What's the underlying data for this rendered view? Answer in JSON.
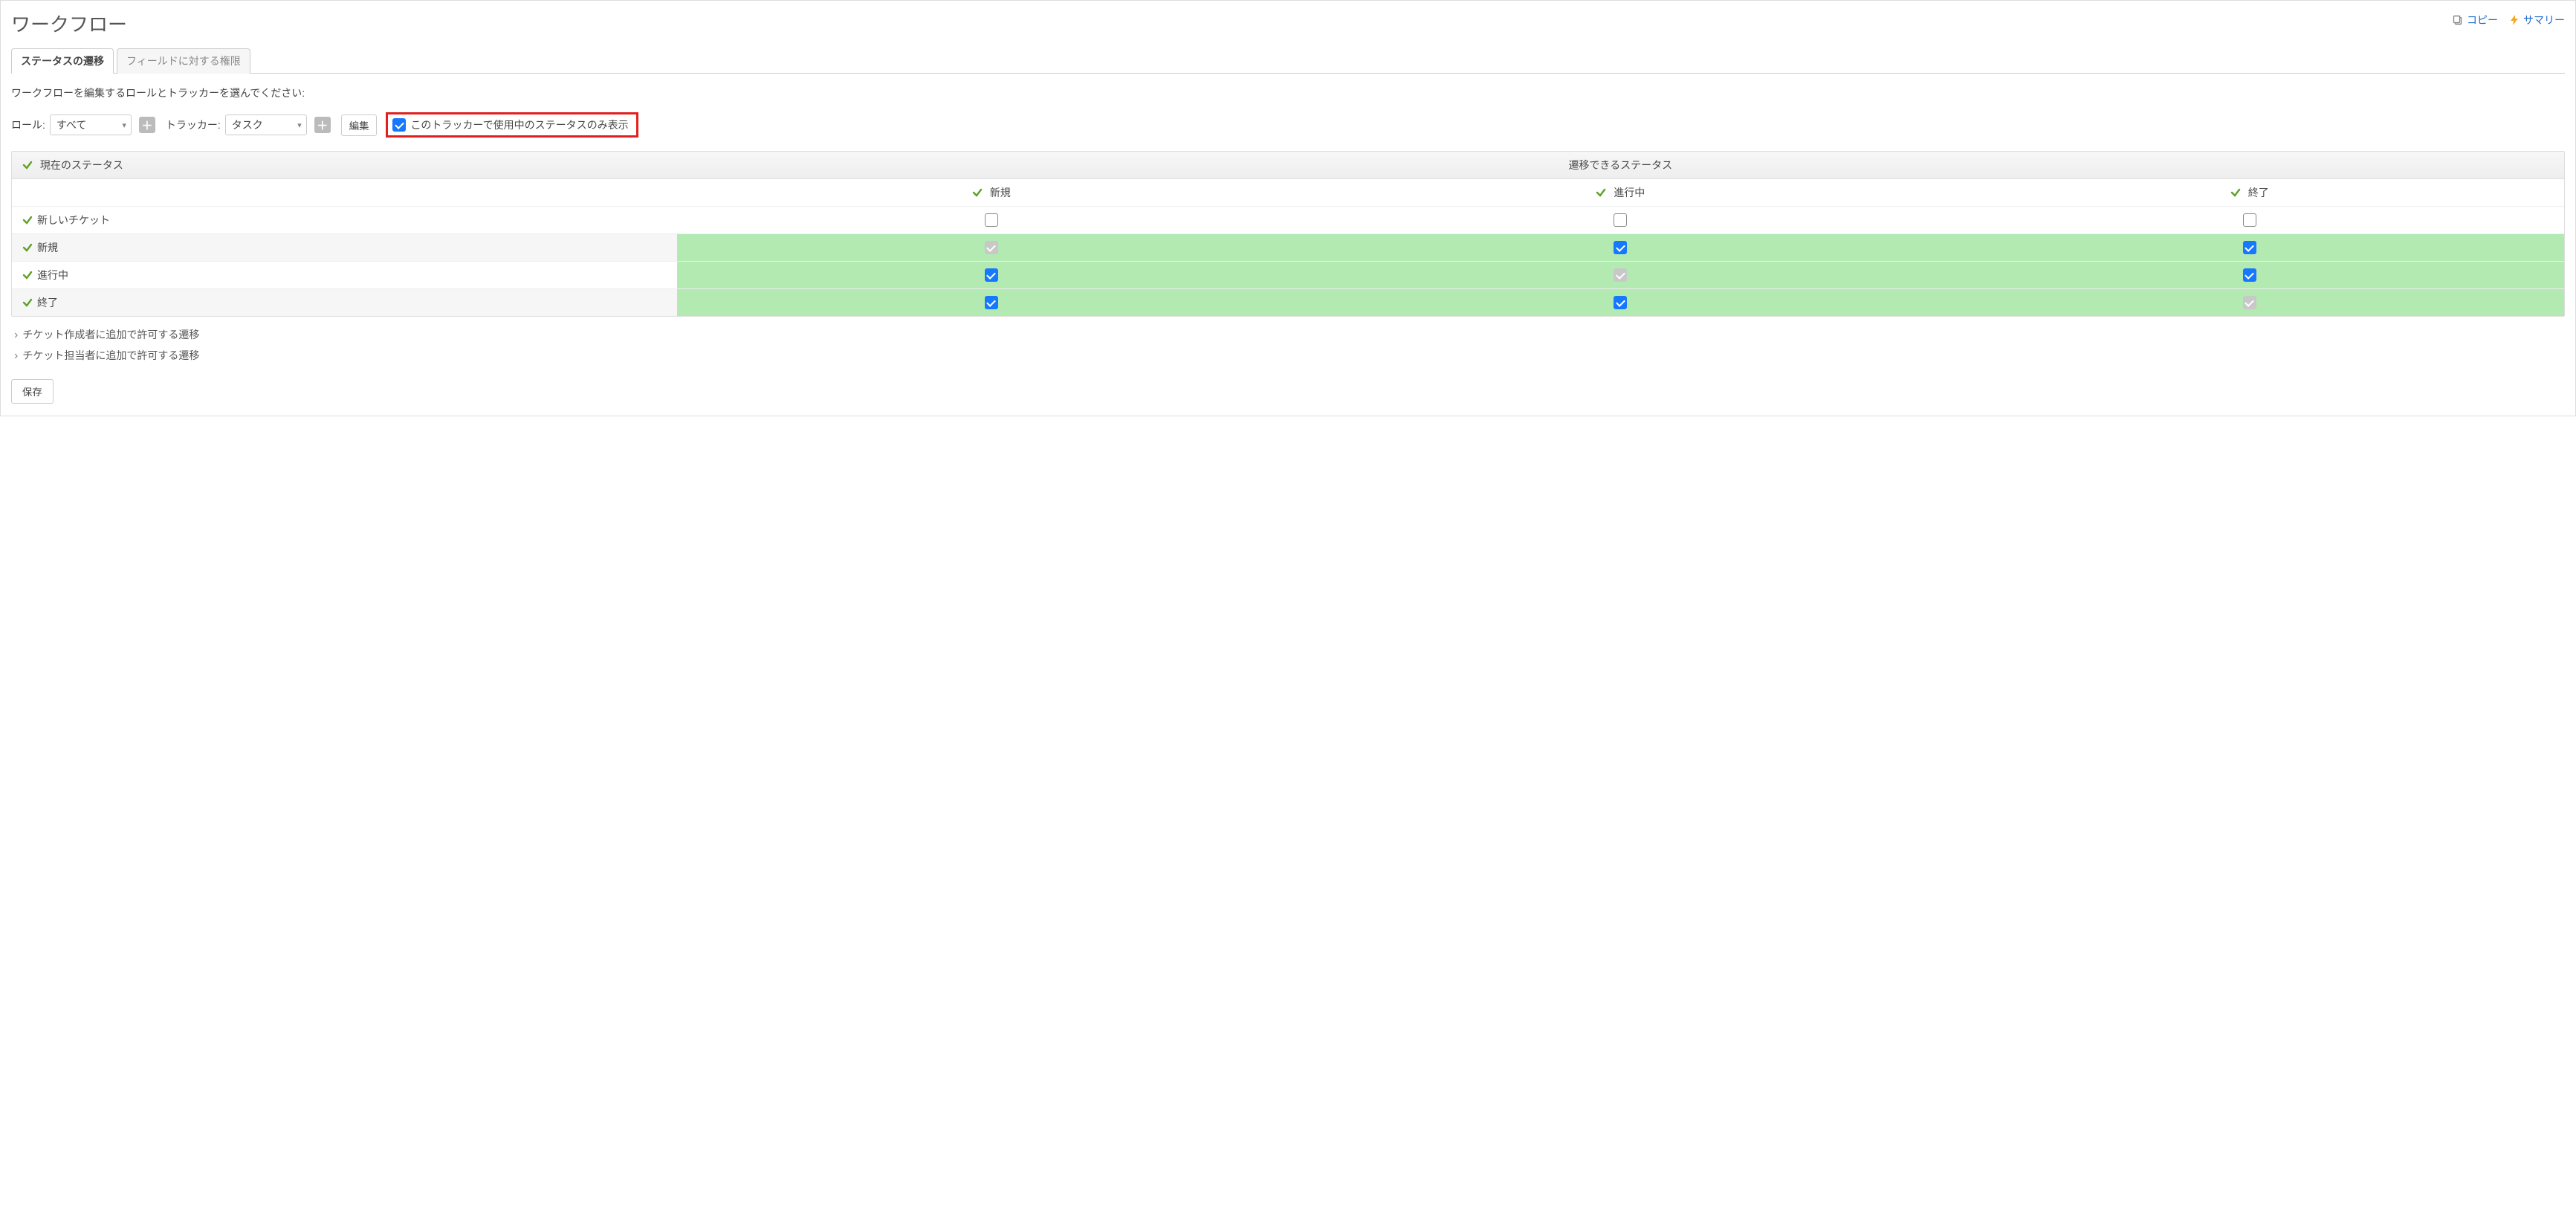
{
  "header": {
    "title": "ワークフロー",
    "actions": {
      "copy": "コピー",
      "summary": "サマリー"
    }
  },
  "tabs": {
    "status_transitions": "ステータスの遷移",
    "field_permissions": "フィールドに対する権限"
  },
  "instruction": "ワークフローを編集するロールとトラッカーを選んでください:",
  "filters": {
    "role_label": "ロール:",
    "role_value": "すべて",
    "tracker_label": "トラッカー:",
    "tracker_value": "タスク",
    "edit_button": "編集",
    "only_used_checkbox_label": "このトラッカーで使用中のステータスのみ表示",
    "only_used_checked": true
  },
  "grid": {
    "current_status_header": "現在のステータス",
    "transitions_header": "遷移できるステータス",
    "columns": [
      "新規",
      "進行中",
      "終了"
    ],
    "rows": [
      {
        "label": "新しいチケット",
        "hl": false,
        "cells": [
          {
            "state": "unchecked"
          },
          {
            "state": "unchecked"
          },
          {
            "state": "unchecked"
          }
        ]
      },
      {
        "label": "新規",
        "hl": true,
        "cells": [
          {
            "state": "disabled-checked"
          },
          {
            "state": "checked"
          },
          {
            "state": "checked"
          }
        ]
      },
      {
        "label": "進行中",
        "hl": true,
        "cells": [
          {
            "state": "checked"
          },
          {
            "state": "disabled-checked"
          },
          {
            "state": "checked"
          }
        ]
      },
      {
        "label": "終了",
        "hl": true,
        "cells": [
          {
            "state": "checked"
          },
          {
            "state": "checked"
          },
          {
            "state": "disabled-checked"
          }
        ]
      }
    ]
  },
  "folds": {
    "author": "チケット作成者に追加で許可する遷移",
    "assignee": "チケット担当者に追加で許可する遷移"
  },
  "save_button": "保存"
}
